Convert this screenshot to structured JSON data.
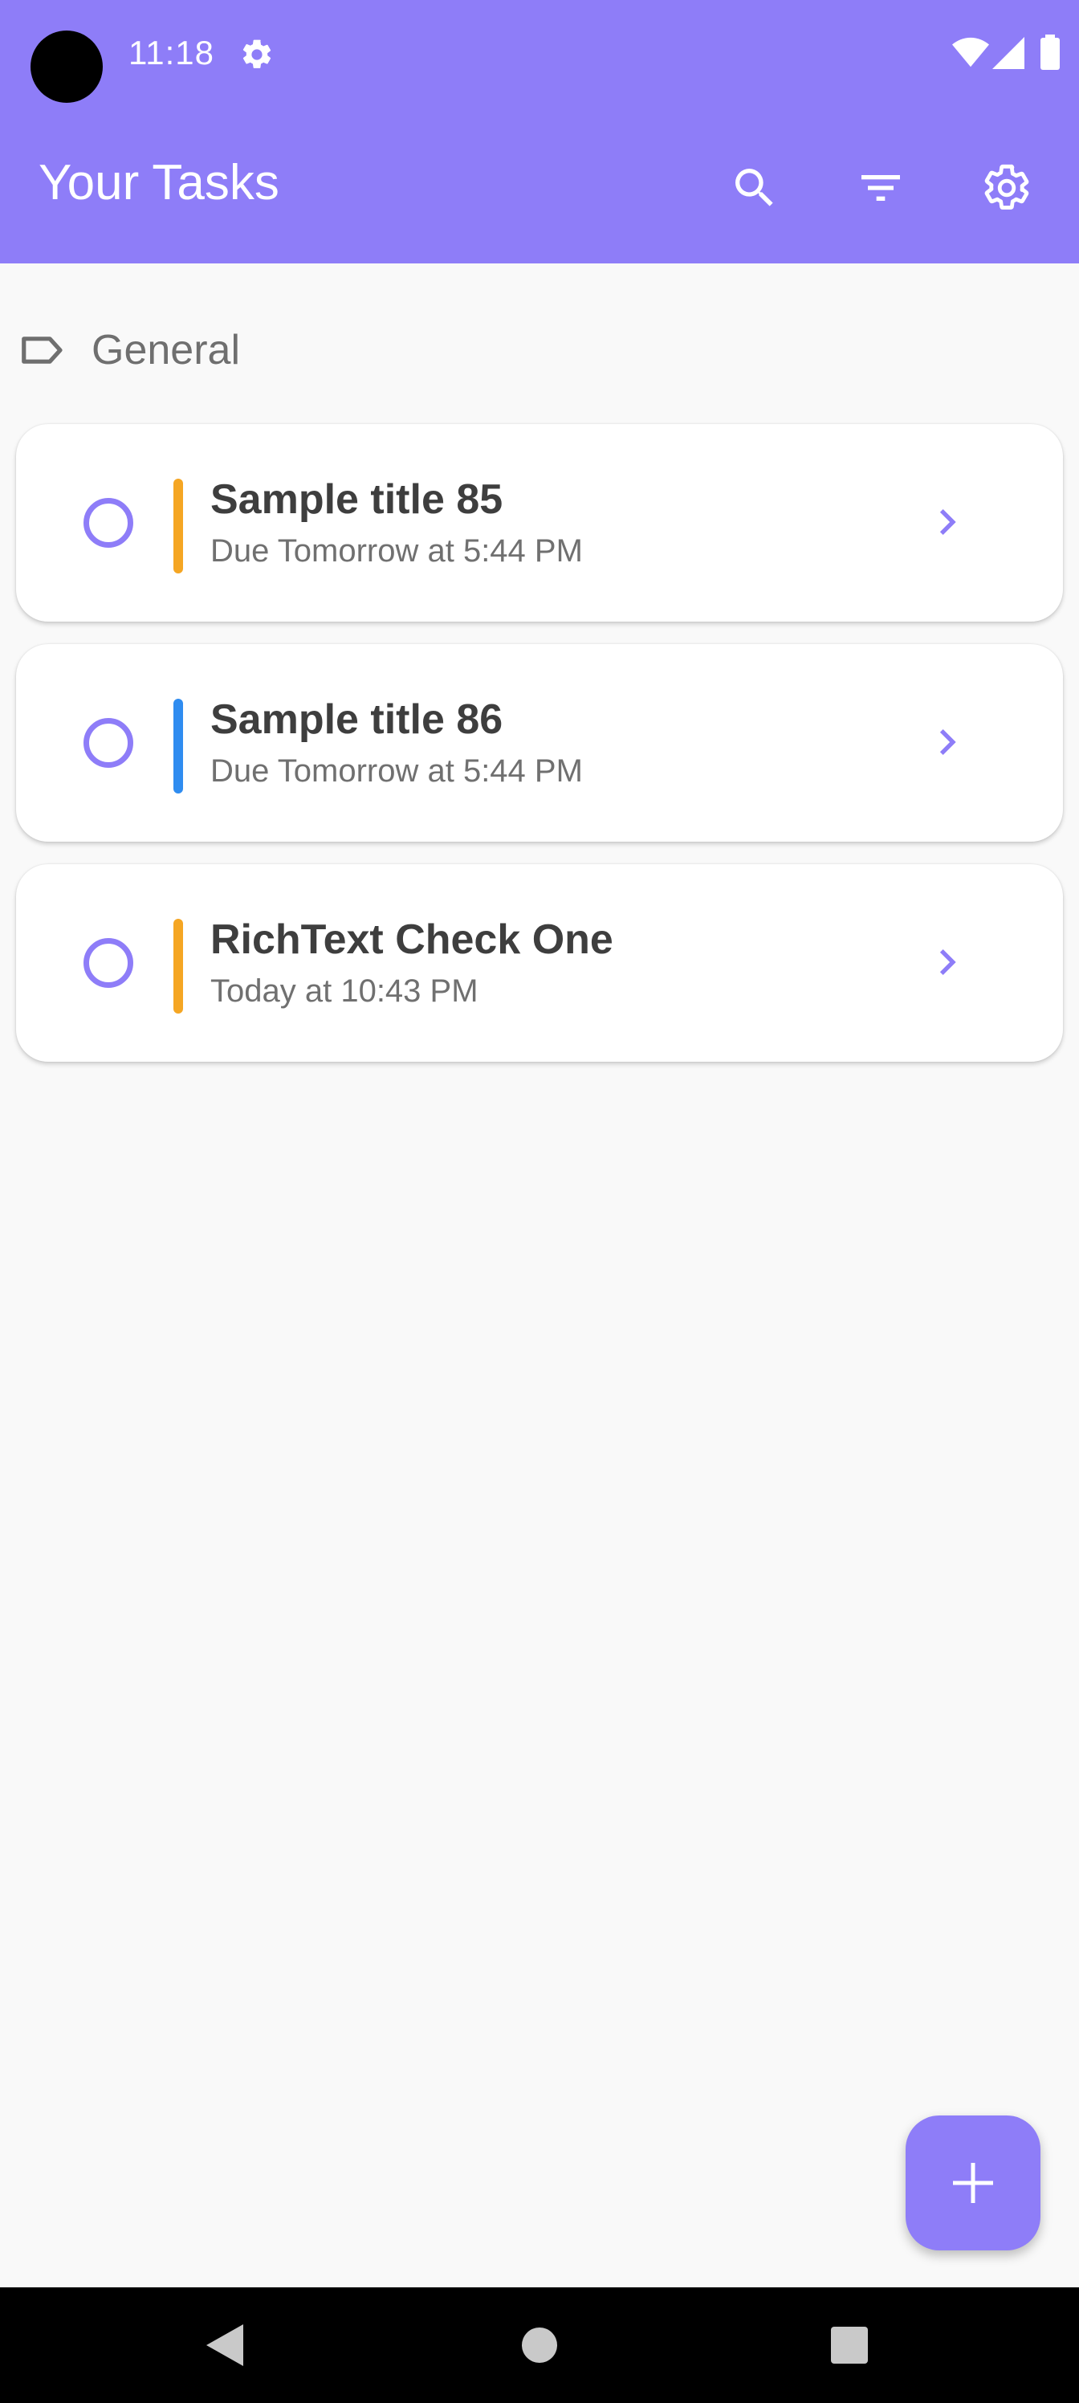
{
  "status_bar": {
    "time": "11:18",
    "icons": [
      "settings-icon",
      "wifi-icon",
      "cellular-signal-icon",
      "battery-icon"
    ]
  },
  "app_bar": {
    "title": "Your Tasks",
    "actions": [
      "search-icon",
      "filter-icon",
      "settings-icon"
    ]
  },
  "section": {
    "icon": "label-tag-icon",
    "label": "General"
  },
  "tasks": [
    {
      "title": "Sample title 85",
      "due": "Due Tomorrow at 5:44 PM",
      "priority_color": "#f5a623"
    },
    {
      "title": "Sample title 86",
      "due": "Due Tomorrow at 5:44 PM",
      "priority_color": "#2f8cf0"
    },
    {
      "title": "RichText Check One",
      "due": "Today at 10:43 PM",
      "priority_color": "#f5a623"
    }
  ],
  "fab": {
    "icon": "add-icon"
  },
  "nav_bar": {
    "buttons": [
      "back-icon",
      "home-icon",
      "recents-icon"
    ]
  },
  "colors": {
    "accent": "#8e7df8",
    "background": "#f9f9f9",
    "card": "#ffffff"
  }
}
